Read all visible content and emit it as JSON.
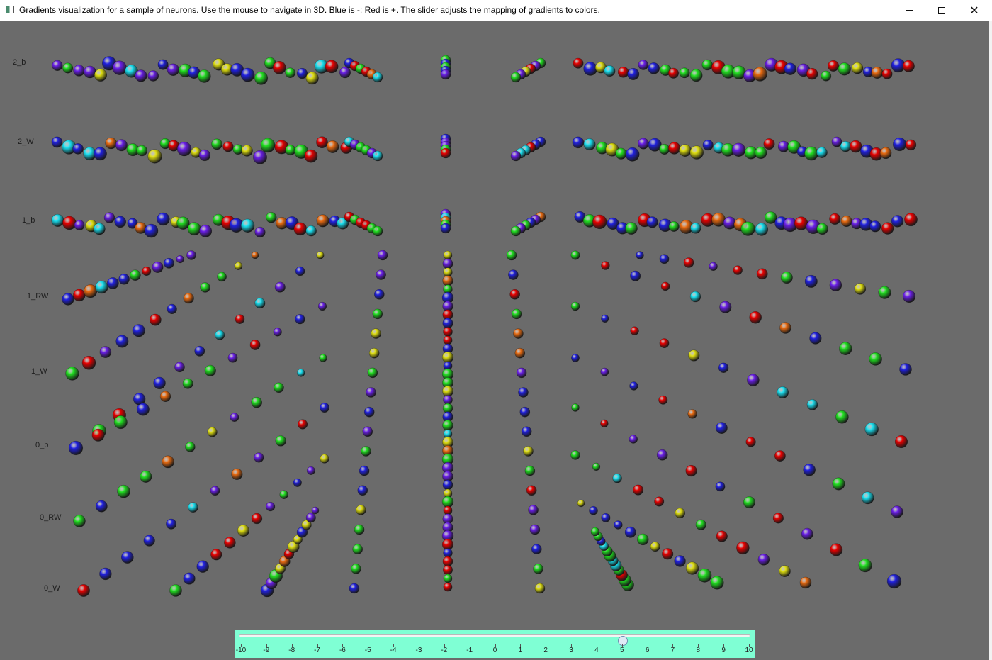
{
  "window": {
    "title": "Gradients visualization for a sample of neurons.  Use the mouse to navigate in 3D.  Blue is -; Red is +.  The slider adjusts the mapping of gradients to colors.",
    "minimize_icon": "minimize-icon",
    "maximize_icon": "maximize-icon",
    "close_icon": "close-icon"
  },
  "scene": {
    "background": "#6b6b6b",
    "row_labels": [
      "2_b",
      "2_W",
      "1_b",
      "1_RW",
      "1_W",
      "0_b",
      "0_RW",
      "0_W"
    ]
  },
  "slider": {
    "background": "#7fffd4",
    "min": -10,
    "max": 10,
    "value": 5,
    "ticks": [
      "-10",
      "-9",
      "-8",
      "-7",
      "-6",
      "-5",
      "-4",
      "-3",
      "-2",
      "-1",
      "0",
      "1",
      "2",
      "3",
      "4",
      "5",
      "6",
      "7",
      "8",
      "9",
      "10"
    ]
  },
  "palette": {
    "red": "#e80000",
    "blue": "#2020e0",
    "violet": "#6a1ee8",
    "cyan": "#19e0f0",
    "green": "#20e020",
    "yellow": "#dede10",
    "orange": "#e86a10"
  }
}
